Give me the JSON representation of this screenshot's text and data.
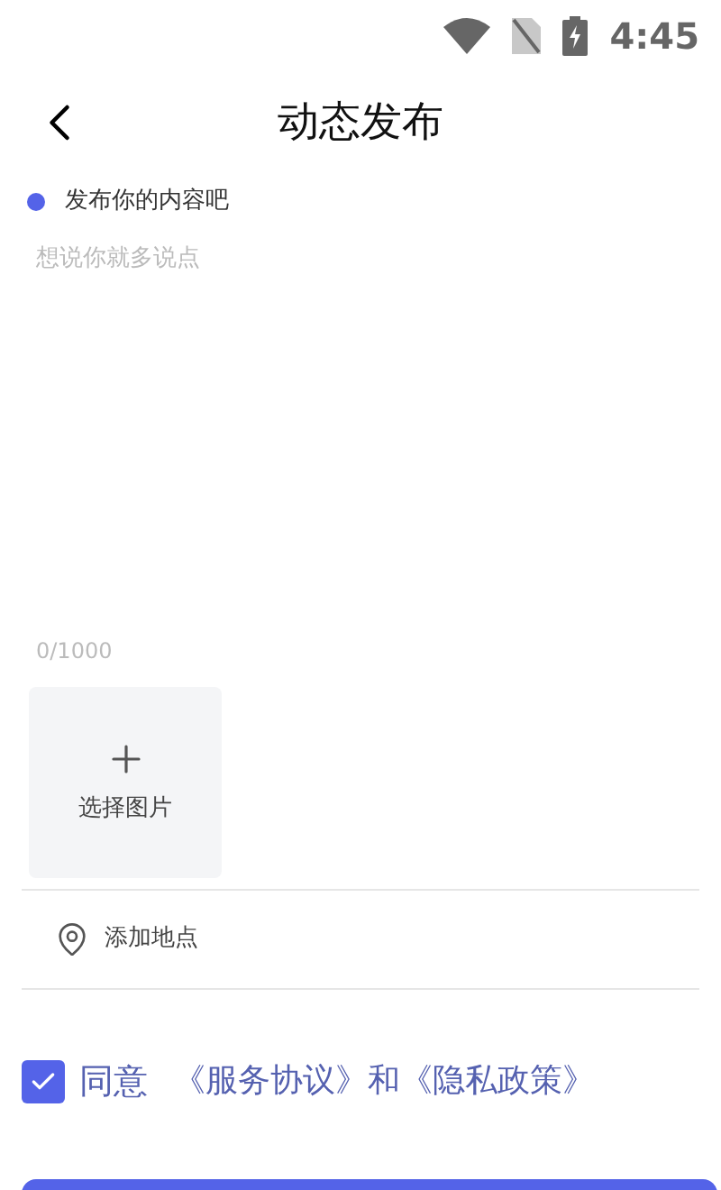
{
  "status_bar": {
    "time": "4:45"
  },
  "header": {
    "title": "动态发布"
  },
  "section": {
    "label": "发布你的内容吧"
  },
  "content_field": {
    "placeholder": "想说你就多说点",
    "counter": "0/1000"
  },
  "image_picker": {
    "label": "选择图片"
  },
  "location": {
    "label": "添加地点"
  },
  "agreement": {
    "checked": true,
    "text": "同意",
    "link_1": "《服务协议》",
    "joiner": "和",
    "link_2": "《隐私政策》"
  }
}
